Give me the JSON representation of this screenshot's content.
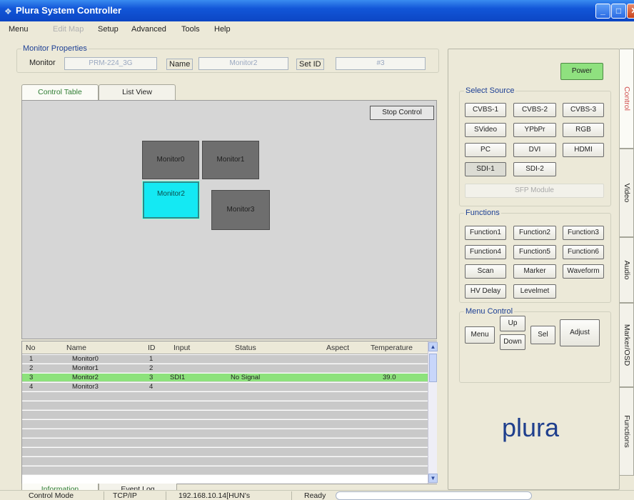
{
  "window": {
    "title": "Plura System Controller",
    "app_icon": "app-icon",
    "min": "_",
    "max": "□",
    "close": "✕"
  },
  "menu": {
    "items": [
      "Menu",
      "Edit Map",
      "Setup",
      "Advanced",
      "Tools",
      "Help"
    ]
  },
  "monitor_properties": {
    "group_title": "Monitor Properties",
    "monitor_label": "Monitor",
    "monitor_value": "PRM-224_3G",
    "name_label": "Name",
    "name_value": "Monitor2",
    "setid_label": "Set ID",
    "setid_value": "#3"
  },
  "view_tabs": [
    "Control Table",
    "List View"
  ],
  "canvas": {
    "stop_button": "Stop Control",
    "monitors": [
      "Monitor0",
      "Monitor1",
      "Monitor2",
      "Monitor3"
    ]
  },
  "table": {
    "columns": [
      "No",
      "Name",
      "ID",
      "Input",
      "Status",
      "Aspect",
      "Temperature"
    ],
    "rows": [
      {
        "no": "1",
        "name": "Monitor0",
        "id": "1",
        "input": "",
        "status": "",
        "aspect": "",
        "temp": ""
      },
      {
        "no": "2",
        "name": "Monitor1",
        "id": "2",
        "input": "",
        "status": "",
        "aspect": "",
        "temp": ""
      },
      {
        "no": "3",
        "name": "Monitor2",
        "id": "3",
        "input": "SDI1",
        "status": "No Signal",
        "aspect": "",
        "temp": "39.0"
      },
      {
        "no": "4",
        "name": "Monitor3",
        "id": "4",
        "input": "",
        "status": "",
        "aspect": "",
        "temp": ""
      }
    ]
  },
  "bottom_tabs": [
    "Information",
    "Event Log"
  ],
  "right_panel": {
    "power": "Power",
    "select_source_title": "Select Source",
    "sources": [
      "CVBS-1",
      "CVBS-2",
      "CVBS-3",
      "SVideo",
      "YPbPr",
      "RGB",
      "PC",
      "DVI",
      "HDMI",
      "SDI-1",
      "SDI-2"
    ],
    "sfp_module": "SFP Module",
    "functions_title": "Functions",
    "functions": [
      "Function1",
      "Function2",
      "Function3",
      "Function4",
      "Function5",
      "Function6",
      "Scan",
      "Marker",
      "Waveform",
      "HV Delay",
      "Levelmet"
    ],
    "menu_control_title": "Menu Control",
    "menu_control": {
      "menu": "Menu",
      "up": "Up",
      "down": "Down",
      "sel": "Sel",
      "adjust": "Adjust"
    },
    "logo": "plura"
  },
  "side_tabs": [
    "Control",
    "Video",
    "Audio",
    "Marker/OSD",
    "Functions"
  ],
  "status_bar": {
    "mode": "Control Mode",
    "protocol": "TCP/IP",
    "address": "192.168.10.14[HUN's",
    "state": "Ready"
  },
  "colors": {
    "selected_monitor": "#14e9f3",
    "highlight_row": "#8de27c",
    "power": "#8fe17f",
    "title_bar": "#1256d8"
  }
}
